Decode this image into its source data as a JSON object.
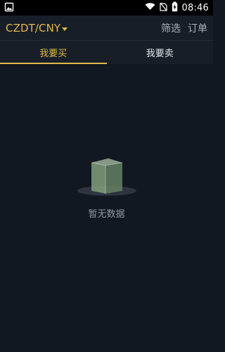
{
  "status_bar": {
    "time": "08:46",
    "icons": [
      "image-icon",
      "wifi-icon",
      "no-sim-icon",
      "battery-icon"
    ]
  },
  "header": {
    "pair_label": "CZDT/CNY",
    "filter_label": "筛选",
    "orders_label": "订单"
  },
  "tabs": [
    {
      "label": "我要买",
      "active": true
    },
    {
      "label": "我要卖",
      "active": false
    }
  ],
  "empty_state": {
    "text": "暂无数据",
    "icon": "empty-box-icon"
  },
  "colors": {
    "accent": "#e0b94a",
    "background": "#121821",
    "header": "#171e28"
  }
}
